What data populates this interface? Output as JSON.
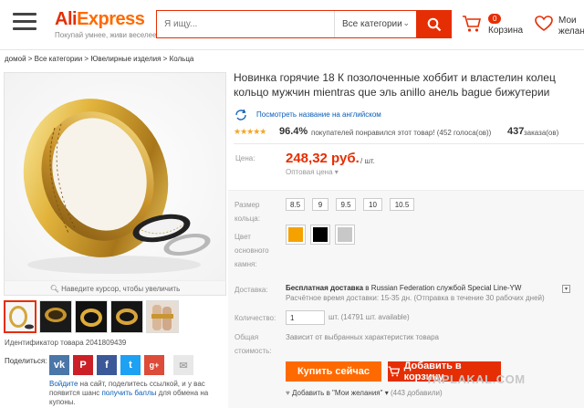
{
  "header": {
    "logo_text": "AliExpress",
    "tagline": "Покупай умнее, живи веселее",
    "search_placeholder": "Я ищу...",
    "category_label": "Все категории",
    "cart_count": "0",
    "cart_label": "Корзина",
    "wishlist_line1": "Мои",
    "wishlist_line2": "желан"
  },
  "breadcrumb": "домой > Все категории > Ювелирные изделия > Кольца",
  "gallery": {
    "zoom_hint": "Наведите курсор, чтобы увеличить",
    "product_id": "Идентификатор товара 2041809439"
  },
  "share": {
    "label": "Поделиться:",
    "text_prefix": "Войдите",
    "text_mid": " на сайт, поделитесь ссылкой, и у вас появится шанс ",
    "text_link": "получить баллы",
    "text_suffix": " для обмена на купоны."
  },
  "product": {
    "title": "Новинка горячие 18 К позолоченные хоббит и властелин колец кольцо мужчин mientras que эль anillo анель bague бижутерии",
    "translate_link": "Посмотреть название на английском",
    "rating_stars": "★★★★★",
    "rating_percent": "96.4%",
    "rating_text": "покупателей понравился этот товар! (452 голоса(ов))",
    "orders_count": "437",
    "orders_label": "заказа(ов)",
    "price_label": "Цена:",
    "price": "248,32 руб.",
    "price_unit": "/ шт.",
    "wholesale": "Оптовая цена ▾"
  },
  "options": {
    "size_label": "Размер кольца:",
    "sizes": [
      "8.5",
      "9",
      "9.5",
      "10",
      "10.5"
    ],
    "color_label": "Цвет основного камня:",
    "colors": [
      "#f5a200",
      "#000000",
      "#c8c8c8"
    ],
    "delivery_label": "Доставка:",
    "delivery_strong": "Бесплатная доставка",
    "delivery_rest": " в Russian Federation службой Special Line-YW",
    "delivery_time": "Расчётное время доставки: 15-35 дн. (Отправка в течение 30 рабочих дней)",
    "qty_label": "Количество:",
    "qty_value": "1",
    "qty_avail": "шт. (14791 шт. available)",
    "total_label": "Общая стоимость:",
    "total_text": "Зависит от выбранных характеристик товара",
    "buy_label": "Купить сейчас",
    "cart_label": "Добавить в корзину",
    "wish_label": "Добавить в \"Мои желания\" ▾",
    "wish_count": "(443 добавили)"
  },
  "watermark": "YAPLAKAL.COM"
}
